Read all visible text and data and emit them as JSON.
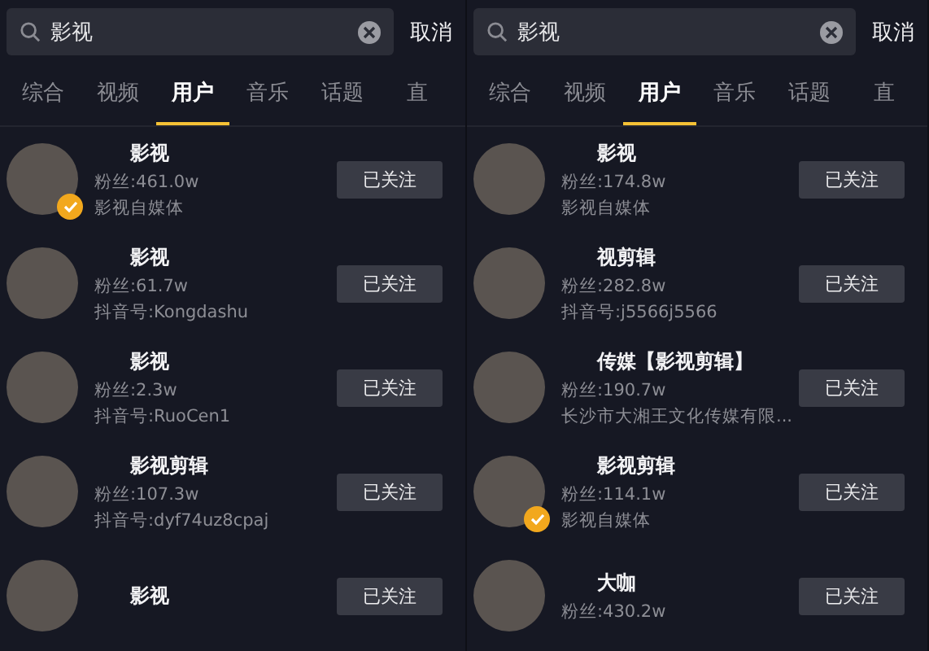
{
  "panels": [
    {
      "search": {
        "value": "影视",
        "cancel": "取消"
      },
      "tabs": [
        {
          "label": "综合",
          "selected": false
        },
        {
          "label": "视频",
          "selected": false
        },
        {
          "label": "用户",
          "selected": true
        },
        {
          "label": "音乐",
          "selected": false
        },
        {
          "label": "话题",
          "selected": false
        },
        {
          "label": "直",
          "selected": false
        }
      ],
      "users": [
        {
          "name": "影视",
          "fans": "粉丝:461.0w",
          "info": "影视自媒体",
          "verified": true,
          "button": "已关注"
        },
        {
          "name": "影视",
          "fans": "粉丝:61.7w",
          "info": "抖音号:Kongdashu",
          "verified": false,
          "button": "已关注"
        },
        {
          "name": "影视",
          "fans": "粉丝:2.3w",
          "info": "抖音号:RuoCen1",
          "verified": false,
          "button": "已关注"
        },
        {
          "name": "影视剪辑",
          "fans": "粉丝:107.3w",
          "info": "抖音号:dyf74uz8cpaj",
          "verified": false,
          "button": "已关注"
        },
        {
          "name": "影视",
          "verified": false,
          "button": "已关注"
        }
      ]
    },
    {
      "search": {
        "value": "影视",
        "cancel": "取消"
      },
      "tabs": [
        {
          "label": "综合",
          "selected": false
        },
        {
          "label": "视频",
          "selected": false
        },
        {
          "label": "用户",
          "selected": true
        },
        {
          "label": "音乐",
          "selected": false
        },
        {
          "label": "话题",
          "selected": false
        },
        {
          "label": "直",
          "selected": false
        }
      ],
      "users": [
        {
          "name": "影视",
          "fans": "粉丝:174.8w",
          "info": "影视自媒体",
          "verified": false,
          "button": "已关注"
        },
        {
          "name": "视剪辑",
          "fans": "粉丝:282.8w",
          "info": "抖音号:j5566j5566",
          "verified": false,
          "button": "已关注"
        },
        {
          "name": "传媒【影视剪辑】",
          "fans": "粉丝:190.7w",
          "info": "长沙市大湘王文化传媒有限...",
          "verified": false,
          "button": "已关注"
        },
        {
          "name": "影视剪辑",
          "fans": "粉丝:114.1w",
          "info": "影视自媒体",
          "verified": true,
          "button": "已关注"
        },
        {
          "name": "大咖",
          "fans": "粉丝:430.2w",
          "verified": false,
          "button": "已关注"
        }
      ]
    }
  ]
}
